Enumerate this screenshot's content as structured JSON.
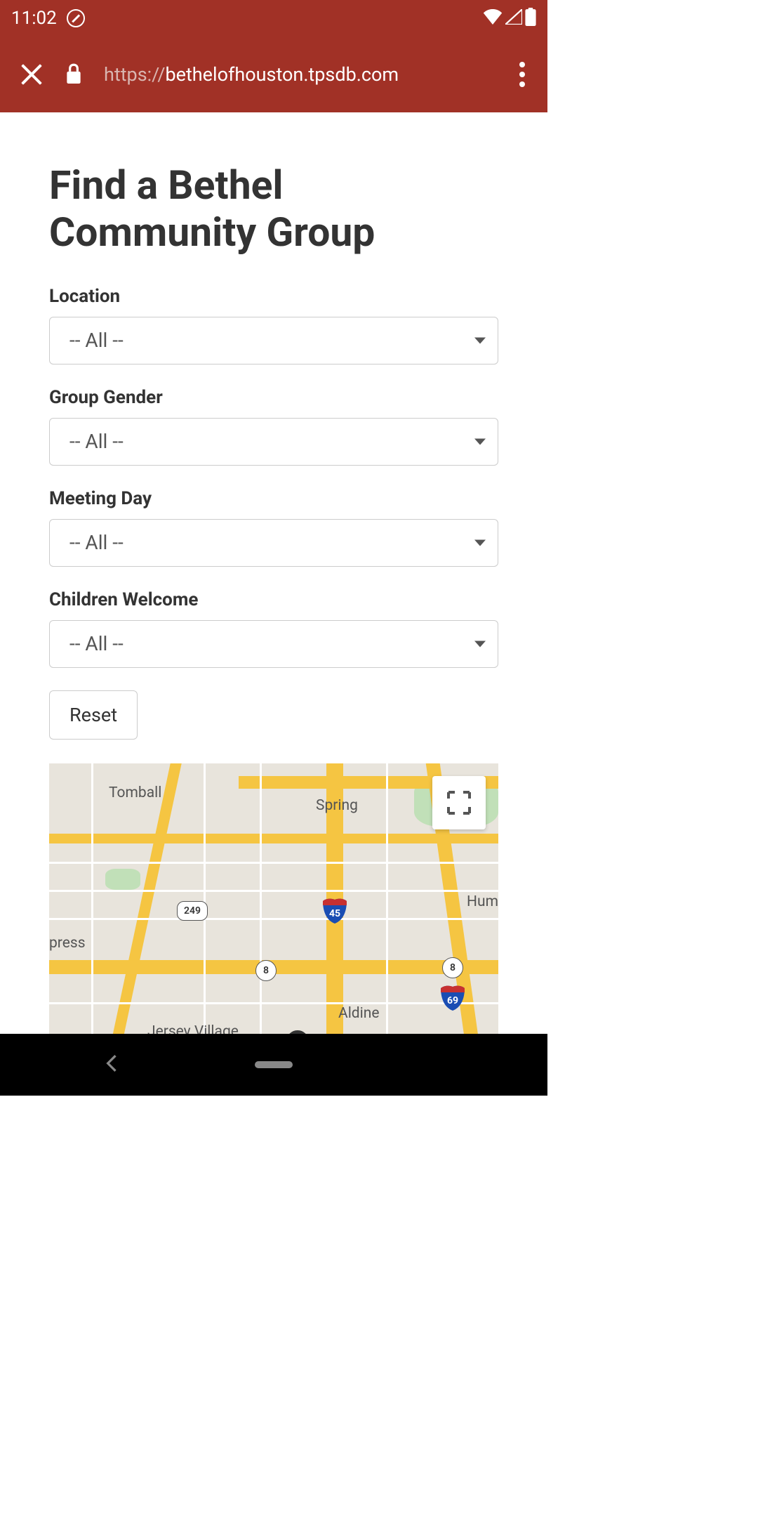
{
  "statusBar": {
    "time": "11:02"
  },
  "browserBar": {
    "urlPrefix": "https://",
    "urlDomain": "bethelofhouston.tpsdb.com"
  },
  "page": {
    "title": "Find a Bethel Community Group"
  },
  "form": {
    "fields": [
      {
        "label": "Location",
        "value": "-- All --"
      },
      {
        "label": "Group Gender",
        "value": "-- All --"
      },
      {
        "label": "Meeting Day",
        "value": "-- All --"
      },
      {
        "label": "Children Welcome",
        "value": "-- All --"
      }
    ],
    "resetLabel": "Reset"
  },
  "map": {
    "cities": {
      "tomball": "Tomball",
      "spring": "Spring",
      "cypress": "press",
      "aldine": "Aldine",
      "jerseyVillage": "Jersey Village",
      "humble": "Hum"
    },
    "highways": {
      "h249": "249",
      "h8a": "8",
      "h8b": "8",
      "i45": "45",
      "i69": "69"
    }
  }
}
